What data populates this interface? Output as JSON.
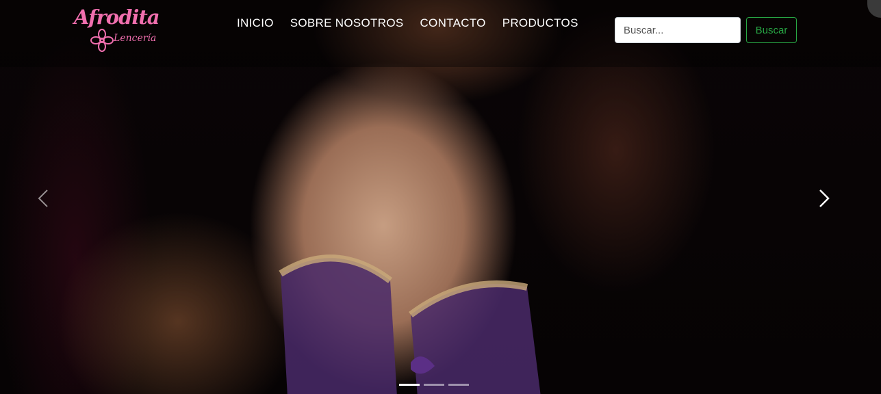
{
  "brand": {
    "logo_title": "Afrodita",
    "logo_subtitle": "Lencería",
    "logo_color": "#f06fae"
  },
  "nav": {
    "items": [
      {
        "label": "INICIO"
      },
      {
        "label": "SOBRE NOSOTROS"
      },
      {
        "label": "CONTACTO"
      },
      {
        "label": "PRODUCTOS"
      }
    ]
  },
  "search": {
    "placeholder": "Buscar...",
    "value": "",
    "button_label": "Buscar",
    "button_color": "#28a745"
  },
  "carousel": {
    "prev_icon": "chevron-left-icon",
    "next_icon": "chevron-right-icon",
    "slide_count": 3,
    "active_slide": 1
  }
}
